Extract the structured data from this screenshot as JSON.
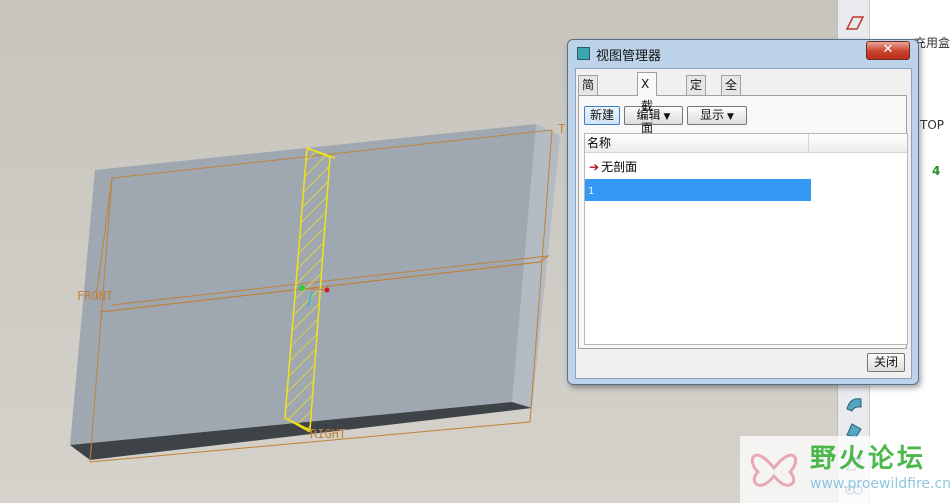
{
  "viewport": {
    "datum_labels": {
      "front": "FRONT",
      "right": "RIGHT",
      "top": "T"
    }
  },
  "right_panel": {
    "text_partial": "充用盒",
    "top_label": "TOP",
    "count_label": "4"
  },
  "dialog": {
    "title": "视图管理器",
    "tabs": [
      "简化表示",
      "X 截面",
      "定向",
      "全部"
    ],
    "active_tab": 1,
    "buttons": {
      "new": "新建",
      "edit": "编辑",
      "display": "显示"
    },
    "list": {
      "column_name": "名称",
      "rows": [
        {
          "label": "无剖面",
          "selected": false
        },
        {
          "label": "1",
          "selected": true
        }
      ]
    },
    "close_label": "关闭"
  },
  "watermark": {
    "name": "野火论坛",
    "url": "www.proewildfire.cn"
  },
  "colors": {
    "selection": "#3399f3",
    "dialog_frame": "#bcd3ea",
    "section_outline": "#f2e21a",
    "datum": "#c0813a"
  }
}
